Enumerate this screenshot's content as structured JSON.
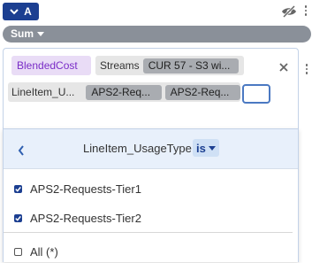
{
  "series_button": {
    "label": "A",
    "icon": "chevron-down-icon"
  },
  "top_icons": {
    "visibility": "eye-off-icon",
    "menu": "kebab-icon"
  },
  "aggregation": {
    "label": "Sum",
    "icon": "caret-down-icon"
  },
  "filter": {
    "measure_chip": "BlendedCost",
    "streams_chip": {
      "label": "Streams",
      "value": "CUR 57 - S3 wi..."
    },
    "usage_type_chip": {
      "label": "LineItem_U...",
      "values": [
        "APS2-Req...",
        "APS2-Req..."
      ]
    },
    "value_input": "",
    "close_icon": "close-icon",
    "menu_icon": "kebab-icon"
  },
  "dropdown": {
    "title": "LineItem_UsageType",
    "operator": "is",
    "back_icon": "chevron-left-icon",
    "items": [
      {
        "label": "APS2-Requests-Tier1",
        "checked": true
      },
      {
        "label": "APS2-Requests-Tier2",
        "checked": true
      }
    ],
    "all_item": {
      "label": "All (*)",
      "checked": false
    }
  },
  "colors": {
    "primary": "#1c3f91",
    "measure_bg": "#e9dcf6",
    "measure_text": "#7a2dc7",
    "aggregation_bar": "#8a9099",
    "dropdown_header": "#e8f0fb"
  }
}
